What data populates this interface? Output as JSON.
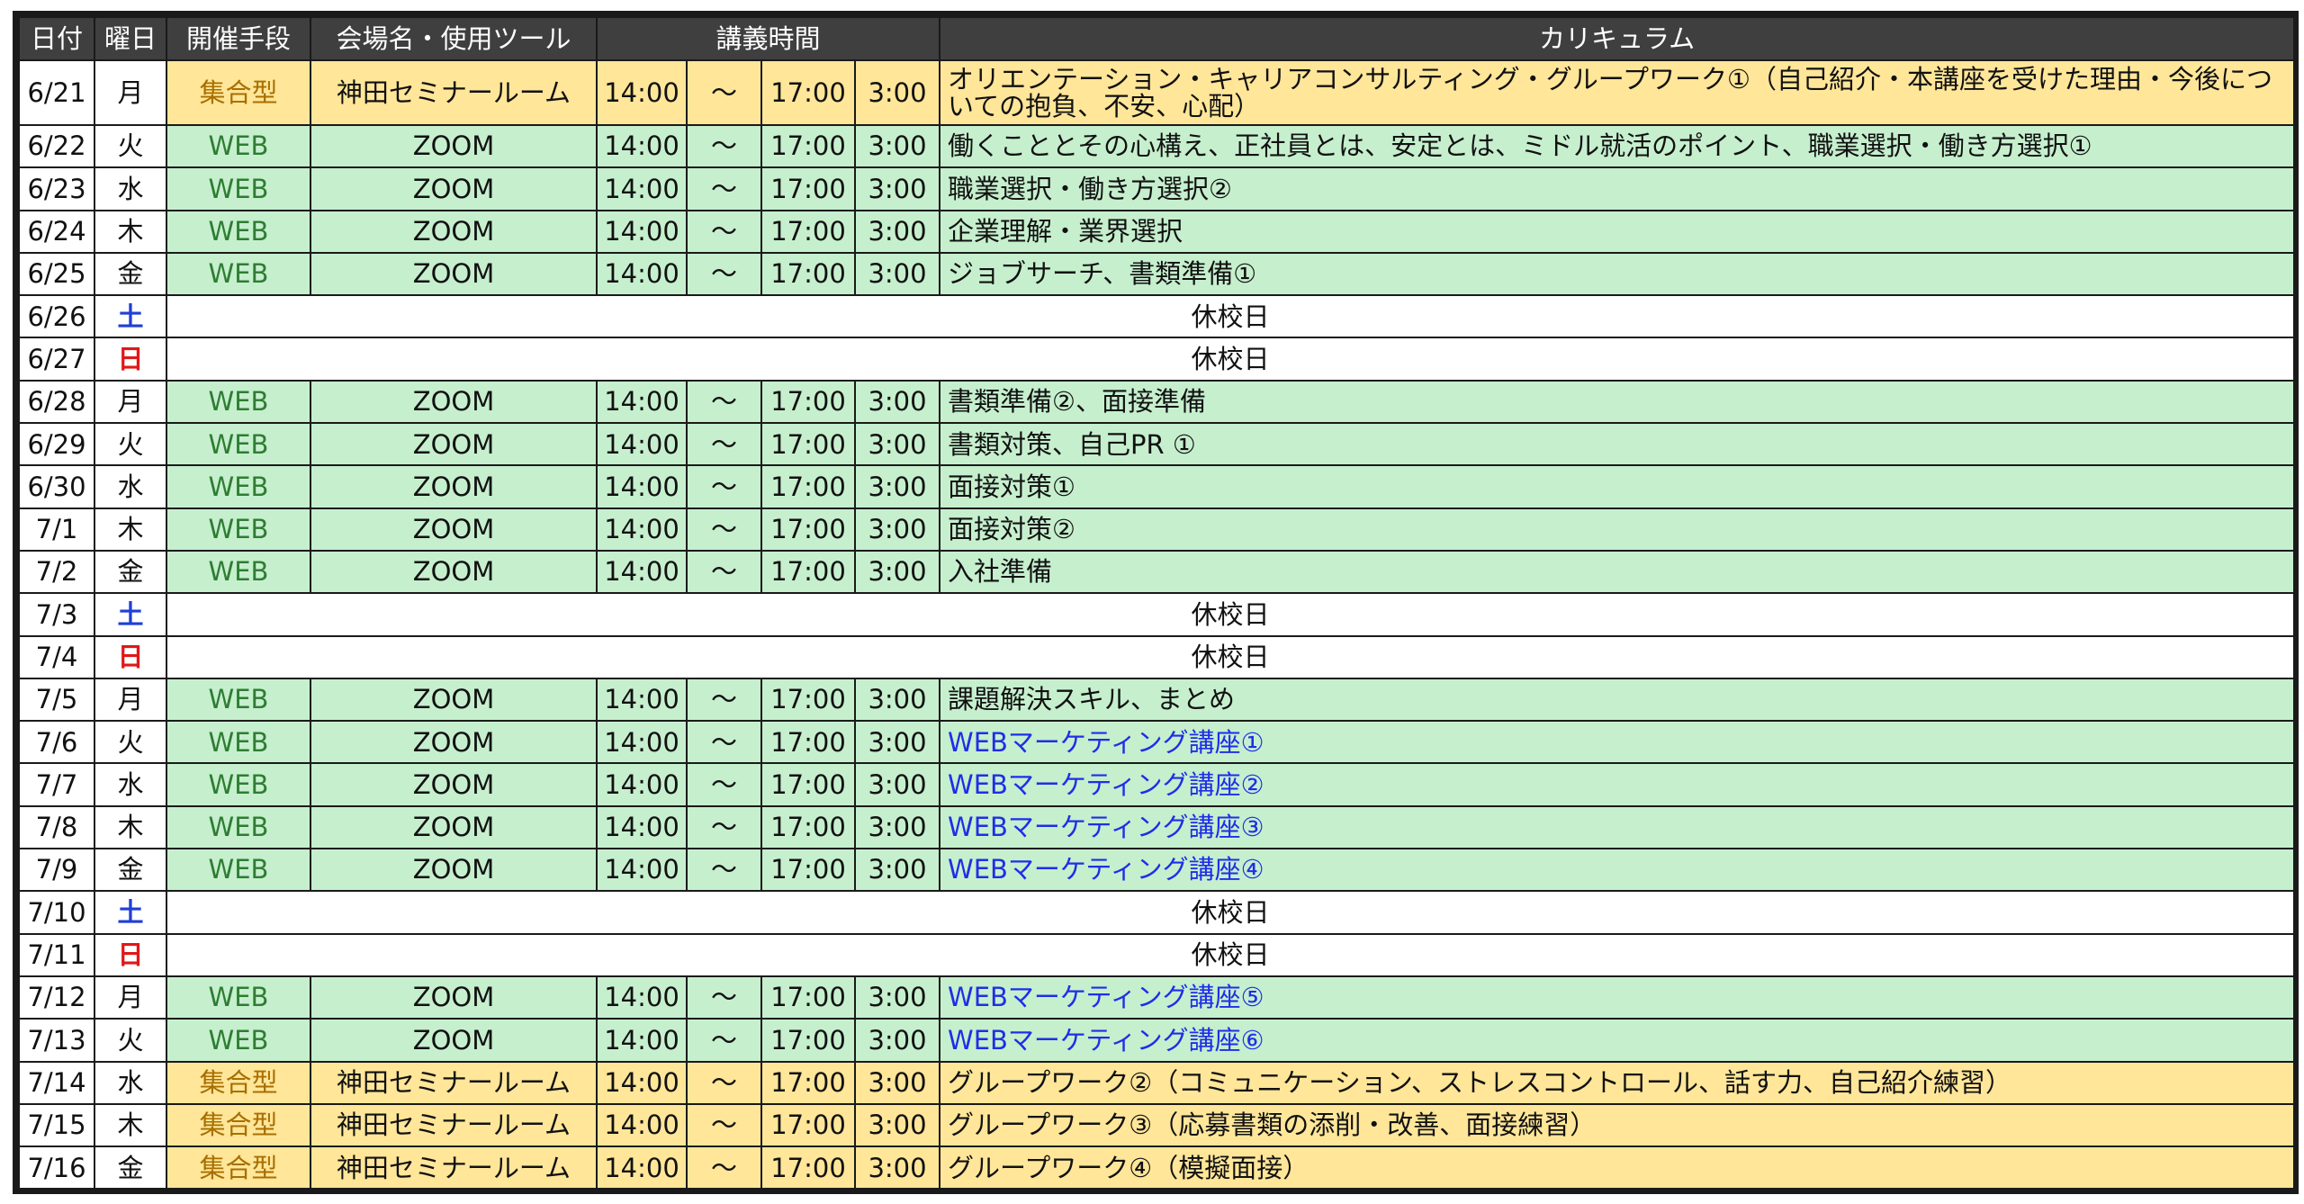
{
  "header": {
    "date": "日付",
    "weekday": "曜日",
    "mode": "開催手段",
    "venue": "会場名・使用ツール",
    "time": "講義時間",
    "curriculum": "カリキュラム"
  },
  "holiday_label": "休校日",
  "colors": {
    "header_bg": "#3f3f3f",
    "web_row": "#c6efce",
    "onsite_row": "#ffe699",
    "web_text": "#2e7d32",
    "onsite_text": "#a86f00",
    "saturday": "#1f3fd6",
    "sunday": "#e01818",
    "highlight_text": "#1f2ee8"
  },
  "rows": [
    {
      "date": "6/21",
      "day": "月",
      "type": "onsite",
      "mode": "集合型",
      "venue": "神田セミナールーム",
      "start": "14:00",
      "tilde": "～",
      "end": "17:00",
      "dur": "3:00",
      "curriculum": "オリエンテーション・キャリアコンサルティング・グループワーク①（自己紹介・本講座を受けた理由・今後についての抱負、不安、心配）"
    },
    {
      "date": "6/22",
      "day": "火",
      "type": "web",
      "mode": "WEB",
      "venue": "ZOOM",
      "start": "14:00",
      "tilde": "～",
      "end": "17:00",
      "dur": "3:00",
      "curriculum": "働くこととその心構え、正社員とは、安定とは、ミドル就活のポイント、職業選択・働き方選択①"
    },
    {
      "date": "6/23",
      "day": "水",
      "type": "web",
      "mode": "WEB",
      "venue": "ZOOM",
      "start": "14:00",
      "tilde": "～",
      "end": "17:00",
      "dur": "3:00",
      "curriculum": "職業選択・働き方選択②"
    },
    {
      "date": "6/24",
      "day": "木",
      "type": "web",
      "mode": "WEB",
      "venue": "ZOOM",
      "start": "14:00",
      "tilde": "～",
      "end": "17:00",
      "dur": "3:00",
      "curriculum": "企業理解・業界選択"
    },
    {
      "date": "6/25",
      "day": "金",
      "type": "web",
      "mode": "WEB",
      "venue": "ZOOM",
      "start": "14:00",
      "tilde": "～",
      "end": "17:00",
      "dur": "3:00",
      "curriculum": "ジョブサーチ、書類準備①"
    },
    {
      "date": "6/26",
      "day": "土",
      "type": "holiday"
    },
    {
      "date": "6/27",
      "day": "日",
      "type": "holiday"
    },
    {
      "date": "6/28",
      "day": "月",
      "type": "web",
      "mode": "WEB",
      "venue": "ZOOM",
      "start": "14:00",
      "tilde": "～",
      "end": "17:00",
      "dur": "3:00",
      "curriculum": "書類準備②、面接準備"
    },
    {
      "date": "6/29",
      "day": "火",
      "type": "web",
      "mode": "WEB",
      "venue": "ZOOM",
      "start": "14:00",
      "tilde": "～",
      "end": "17:00",
      "dur": "3:00",
      "curriculum": "書類対策、自己PR ①"
    },
    {
      "date": "6/30",
      "day": "水",
      "type": "web",
      "mode": "WEB",
      "venue": "ZOOM",
      "start": "14:00",
      "tilde": "～",
      "end": "17:00",
      "dur": "3:00",
      "curriculum": "面接対策①"
    },
    {
      "date": "7/1",
      "day": "木",
      "type": "web",
      "mode": "WEB",
      "venue": "ZOOM",
      "start": "14:00",
      "tilde": "～",
      "end": "17:00",
      "dur": "3:00",
      "curriculum": "面接対策②"
    },
    {
      "date": "7/2",
      "day": "金",
      "type": "web",
      "mode": "WEB",
      "venue": "ZOOM",
      "start": "14:00",
      "tilde": "～",
      "end": "17:00",
      "dur": "3:00",
      "curriculum": "入社準備"
    },
    {
      "date": "7/3",
      "day": "土",
      "type": "holiday"
    },
    {
      "date": "7/4",
      "day": "日",
      "type": "holiday"
    },
    {
      "date": "7/5",
      "day": "月",
      "type": "web",
      "mode": "WEB",
      "venue": "ZOOM",
      "start": "14:00",
      "tilde": "～",
      "end": "17:00",
      "dur": "3:00",
      "curriculum": "課題解決スキル、まとめ"
    },
    {
      "date": "7/6",
      "day": "火",
      "type": "web",
      "mode": "WEB",
      "venue": "ZOOM",
      "start": "14:00",
      "tilde": "～",
      "end": "17:00",
      "dur": "3:00",
      "curriculum": "WEBマーケティング講座①",
      "highlight": true
    },
    {
      "date": "7/7",
      "day": "水",
      "type": "web",
      "mode": "WEB",
      "venue": "ZOOM",
      "start": "14:00",
      "tilde": "～",
      "end": "17:00",
      "dur": "3:00",
      "curriculum": "WEBマーケティング講座②",
      "highlight": true
    },
    {
      "date": "7/8",
      "day": "木",
      "type": "web",
      "mode": "WEB",
      "venue": "ZOOM",
      "start": "14:00",
      "tilde": "～",
      "end": "17:00",
      "dur": "3:00",
      "curriculum": "WEBマーケティング講座③",
      "highlight": true
    },
    {
      "date": "7/9",
      "day": "金",
      "type": "web",
      "mode": "WEB",
      "venue": "ZOOM",
      "start": "14:00",
      "tilde": "～",
      "end": "17:00",
      "dur": "3:00",
      "curriculum": "WEBマーケティング講座④",
      "highlight": true
    },
    {
      "date": "7/10",
      "day": "土",
      "type": "holiday"
    },
    {
      "date": "7/11",
      "day": "日",
      "type": "holiday"
    },
    {
      "date": "7/12",
      "day": "月",
      "type": "web",
      "mode": "WEB",
      "venue": "ZOOM",
      "start": "14:00",
      "tilde": "～",
      "end": "17:00",
      "dur": "3:00",
      "curriculum": "WEBマーケティング講座⑤",
      "highlight": true
    },
    {
      "date": "7/13",
      "day": "火",
      "type": "web",
      "mode": "WEB",
      "venue": "ZOOM",
      "start": "14:00",
      "tilde": "～",
      "end": "17:00",
      "dur": "3:00",
      "curriculum": "WEBマーケティング講座⑥",
      "highlight": true
    },
    {
      "date": "7/14",
      "day": "水",
      "type": "onsite",
      "mode": "集合型",
      "venue": "神田セミナールーム",
      "start": "14:00",
      "tilde": "～",
      "end": "17:00",
      "dur": "3:00",
      "curriculum": "グループワーク②（コミュニケーション、ストレスコントロール、話す力、自己紹介練習）"
    },
    {
      "date": "7/15",
      "day": "木",
      "type": "onsite",
      "mode": "集合型",
      "venue": "神田セミナールーム",
      "start": "14:00",
      "tilde": "～",
      "end": "17:00",
      "dur": "3:00",
      "curriculum": "グループワーク③（応募書類の添削・改善、面接練習）"
    },
    {
      "date": "7/16",
      "day": "金",
      "type": "onsite",
      "mode": "集合型",
      "venue": "神田セミナールーム",
      "start": "14:00",
      "tilde": "～",
      "end": "17:00",
      "dur": "3:00",
      "curriculum": "グループワーク④（模擬面接）"
    }
  ]
}
